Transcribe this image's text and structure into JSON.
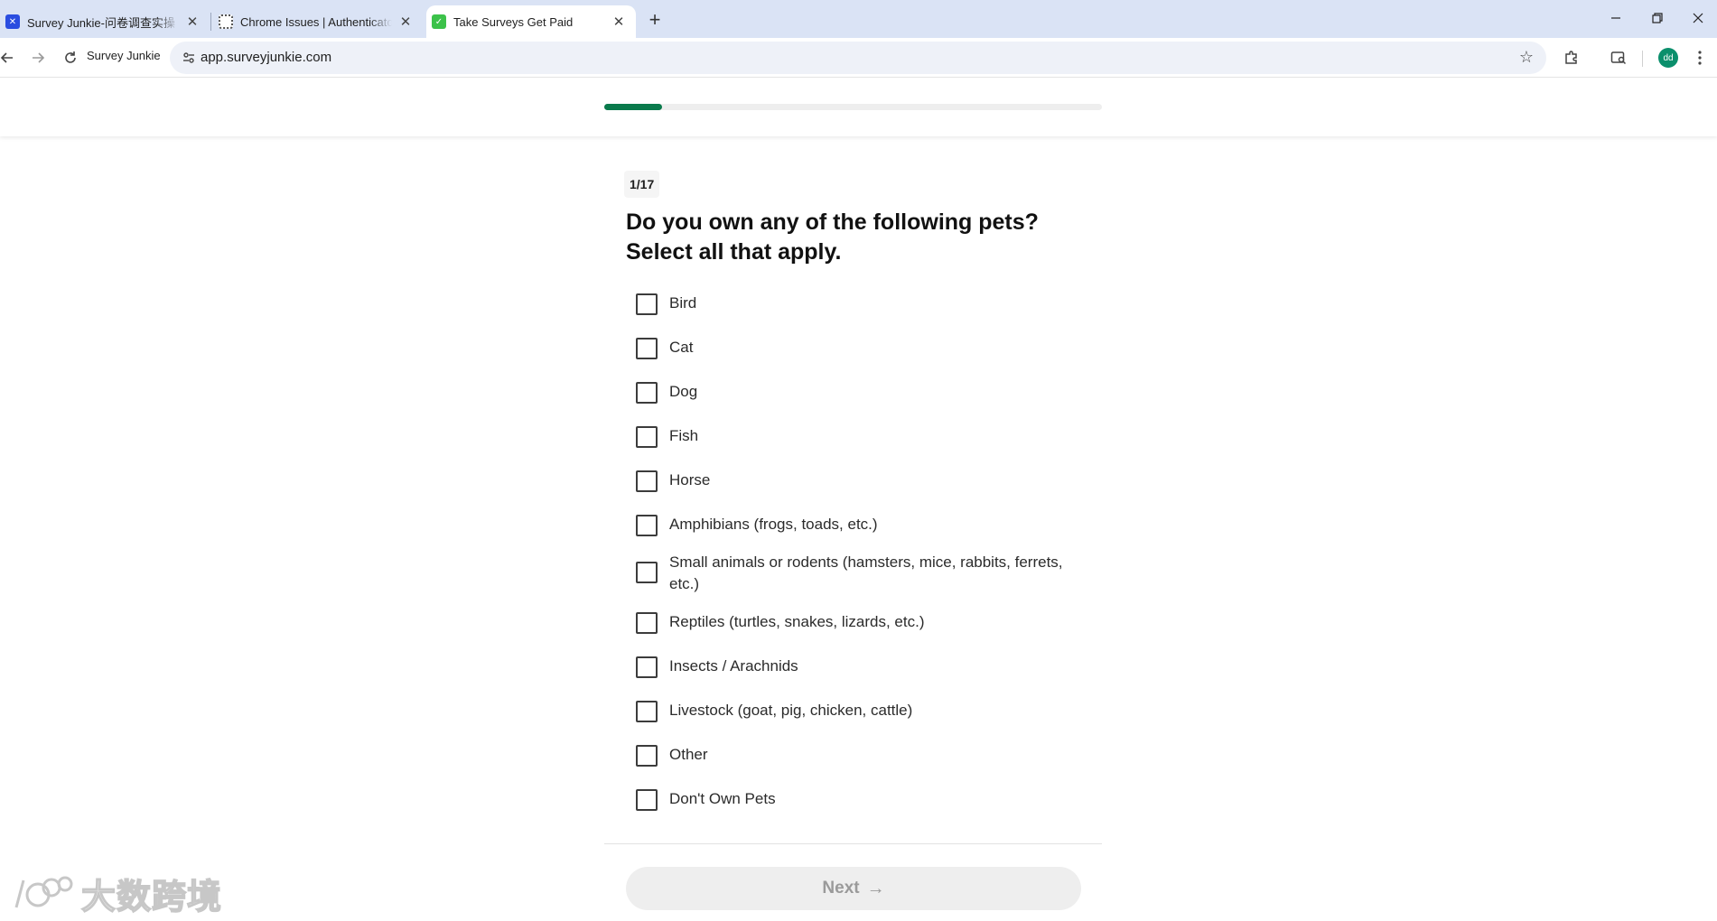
{
  "browser": {
    "tabs": [
      {
        "title": "Survey Junkie-问卷调查实操",
        "favicon": "survey-junkie-favicon",
        "favicon_color": "#2a4de0"
      },
      {
        "title": "Chrome Issues | Authenticato",
        "favicon": "qr-favicon",
        "favicon_color": "#555555"
      },
      {
        "title": "Take Surveys Get Paid",
        "favicon": "green-check-favicon",
        "favicon_color": "#3cc24a"
      }
    ],
    "site_chip": "Survey Junkie",
    "url": "app.surveyjunkie.com",
    "profile_initials": "dd"
  },
  "survey": {
    "progress_fraction": 0.117,
    "counter": "1/17",
    "question_line1": "Do you own any of the following pets?",
    "question_line2": "Select all that apply.",
    "options": [
      "Bird",
      "Cat",
      "Dog",
      "Fish",
      "Horse",
      "Amphibians (frogs, toads, etc.)",
      "Small animals or rodents (hamsters, mice, rabbits, ferrets, etc.)",
      "Reptiles (turtles, snakes, lizards, etc.)",
      "Insects / Arachnids",
      "Livestock (goat, pig, chicken, cattle)",
      "Other",
      "Don't Own Pets"
    ],
    "next_label": "Next"
  },
  "watermark": {
    "text": "大数跨境"
  },
  "colors": {
    "progress": "#0a7a4c",
    "tab_strip": "#dae3f5",
    "avatar": "#0b8f6c"
  }
}
